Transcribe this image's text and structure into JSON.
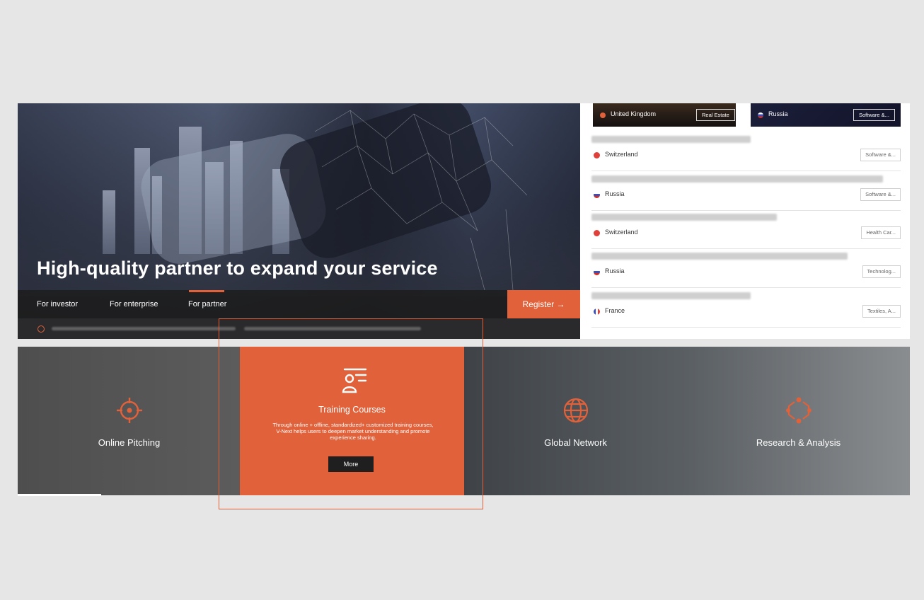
{
  "hero": {
    "title": "High-quality partner to expand your service",
    "nav": [
      "For investor",
      "For enterprise",
      "For partner"
    ],
    "active_nav_index": 2,
    "register_label": "Register →"
  },
  "projects": {
    "featured": [
      {
        "country": "United Kingdom",
        "tag": "Real Estate",
        "flag_color": "#e0613a"
      },
      {
        "country": "Russia",
        "tag": "Software &...",
        "flag_color": "#d52b1e"
      }
    ],
    "rows": [
      {
        "country": "Switzerland",
        "tag": "Software &...",
        "flag_color": "#e0403a"
      },
      {
        "country": "Russia",
        "tag": "Software &...",
        "flag_color": "#3b4fb5"
      },
      {
        "country": "Switzerland",
        "tag": "Health Car...",
        "flag_color": "#e0403a"
      },
      {
        "country": "Russia",
        "tag": "Technolog...",
        "flag_color": "#3b4fb5"
      },
      {
        "country": "France",
        "tag": "Textiles, A...",
        "flag_color": "#3b4fb5"
      }
    ]
  },
  "features": [
    {
      "label": "Online Pitching",
      "icon": "crosshair-icon"
    },
    {
      "label": "Training Courses",
      "icon": "training-icon",
      "description": "Through online + offline, standardized+ customized training courses, V-Next helps users to deepen market understanding and promote experience sharing.",
      "button": "More"
    },
    {
      "label": "Global Network",
      "icon": "globe-icon"
    },
    {
      "label": "Research & Analysis",
      "icon": "network-hexagon-icon"
    }
  ],
  "colors": {
    "accent": "#e0613a",
    "dark": "#1f1f1f",
    "background": "#e6e6e6"
  }
}
